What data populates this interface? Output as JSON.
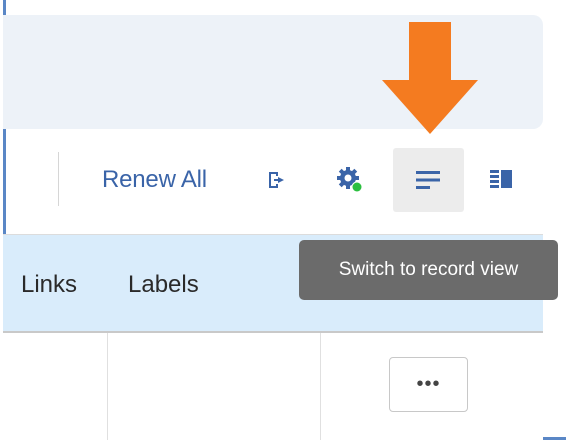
{
  "toolbar": {
    "renew_all_label": "Renew All",
    "export_icon": "export-icon",
    "settings_icon": "settings-gear-icon",
    "record_view_icon": "record-view-icon",
    "columns_icon": "columns-view-icon"
  },
  "tooltip": {
    "text": "Switch to record view"
  },
  "table": {
    "headers": [
      "Links",
      "Labels"
    ],
    "row_actions_label": "•••"
  },
  "colors": {
    "accent_blue": "#3a64a8",
    "annotation_orange": "#f47b20",
    "status_green": "#2bbf3f",
    "header_bg": "#d9ecfb",
    "tooltip_bg": "#6b6b6b"
  }
}
